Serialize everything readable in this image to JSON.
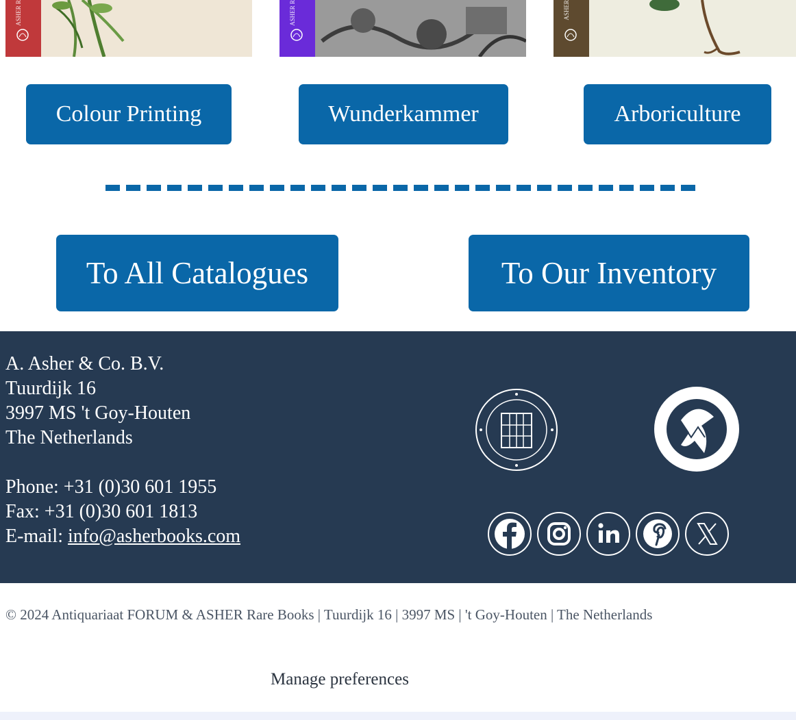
{
  "catalogue_links": [
    {
      "label": "Colour Printing",
      "spine_color": "#c0393b",
      "spine_text": "ASHER R"
    },
    {
      "label": "Wunderkammer",
      "spine_color": "#6a2bd9",
      "spine_text": "ASHER R"
    },
    {
      "label": "Arboriculture",
      "spine_color": "#5e4a2f",
      "spine_text": "ASHER"
    }
  ],
  "main_buttons": {
    "all_catalogues": "To All Catalogues",
    "inventory": "To Our Inventory"
  },
  "footer": {
    "company": "A. Asher & Co. B.V.",
    "street": "Tuurdijk 16",
    "postal": "3997 MS 't Goy-Houten",
    "country": "The Netherlands",
    "phone": "Phone: +31 (0)30 601 1955",
    "fax": "Fax: +31 (0)30 601 1813",
    "email_label": "E-mail: ",
    "email": "info@asherbooks.com",
    "logos": [
      "ilab-seal-logo",
      "nvva-logo"
    ],
    "social": [
      "facebook-icon",
      "instagram-icon",
      "linkedin-icon",
      "pinterest-icon",
      "x-icon"
    ]
  },
  "copyright": "© 2024 Antiquariaat FORUM & ASHER Rare Books | Tuurdijk 16 | 3997 MS | 't Goy-Houten | The Netherlands",
  "manage_preferences": "Manage preferences",
  "colors": {
    "button_blue": "#0a67a8",
    "footer_bg": "#263a52"
  }
}
